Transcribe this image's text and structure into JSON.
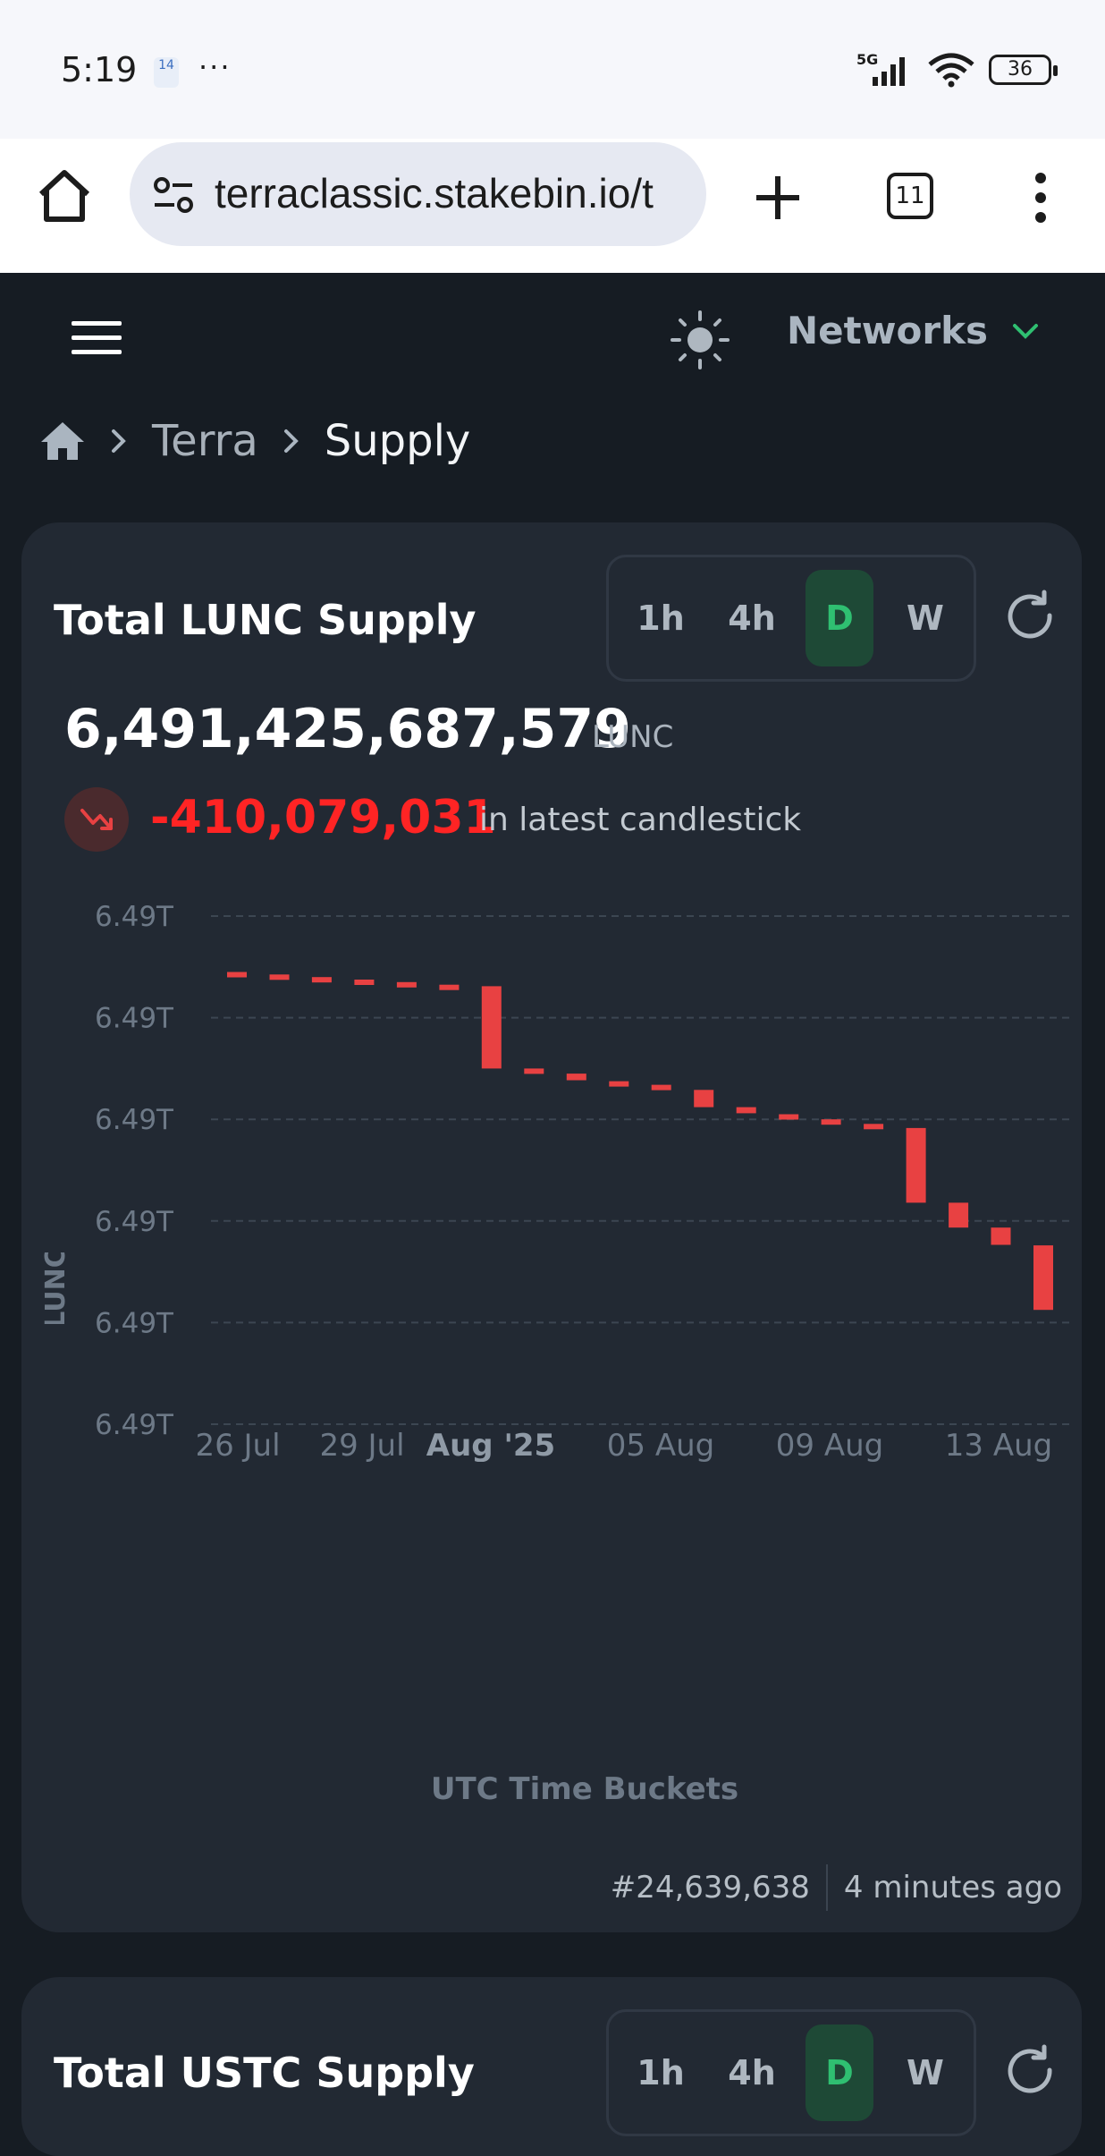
{
  "status_bar": {
    "time": "5:19",
    "notification": "14",
    "more": "···",
    "network": "5G",
    "battery": "36"
  },
  "browser": {
    "url": "terraclassic.stakebin.io/t",
    "tabs_count": "11"
  },
  "header": {
    "networks_label": "Networks"
  },
  "breadcrumb": {
    "items": [
      "Terra",
      "Supply"
    ]
  },
  "supply_card": {
    "title": "Total LUNC Supply",
    "timeframes": [
      "1h",
      "4h",
      "D",
      "W"
    ],
    "active_timeframe": "D",
    "value": "6,491,425,687,579",
    "unit": "LUNC",
    "change": "-410,079,031",
    "change_text": "in latest candlestick",
    "block": "#24,639,638",
    "updated": "4 minutes ago"
  },
  "chart_data": {
    "type": "candlestick",
    "ylabel": "LUNC",
    "xlabel": "UTC Time Buckets",
    "y_tick_labels": [
      "6.49T",
      "6.49T",
      "6.49T",
      "6.49T",
      "6.49T",
      "6.49T"
    ],
    "x_tick_labels": [
      "26 Jul",
      "29 Jul",
      "Aug '25",
      "05 Aug",
      "09 Aug",
      "13 Aug"
    ],
    "x_tick_bold": [
      false,
      false,
      true,
      false,
      false,
      false
    ],
    "candle_color": "#e84142",
    "grid": "dashed horizontal",
    "candles": [
      {
        "open": 0.89,
        "close": 0.886
      },
      {
        "open": 0.885,
        "close": 0.881
      },
      {
        "open": 0.88,
        "close": 0.876
      },
      {
        "open": 0.875,
        "close": 0.871
      },
      {
        "open": 0.87,
        "close": 0.866
      },
      {
        "open": 0.865,
        "close": 0.861
      },
      {
        "open": 0.862,
        "close": 0.7
      },
      {
        "open": 0.7,
        "close": 0.692
      },
      {
        "open": 0.69,
        "close": 0.677
      },
      {
        "open": 0.675,
        "close": 0.667
      },
      {
        "open": 0.668,
        "close": 0.659
      },
      {
        "open": 0.658,
        "close": 0.624
      },
      {
        "open": 0.624,
        "close": 0.612
      },
      {
        "open": 0.61,
        "close": 0.6
      },
      {
        "open": 0.6,
        "close": 0.592
      },
      {
        "open": 0.591,
        "close": 0.583
      },
      {
        "open": 0.583,
        "close": 0.436
      },
      {
        "open": 0.436,
        "close": 0.387
      },
      {
        "open": 0.387,
        "close": 0.353
      },
      {
        "open": 0.352,
        "close": 0.225
      }
    ]
  },
  "second_card": {
    "title": "Total USTC Supply",
    "timeframes": [
      "1h",
      "4h",
      "D",
      "W"
    ],
    "active_timeframe": "D"
  }
}
